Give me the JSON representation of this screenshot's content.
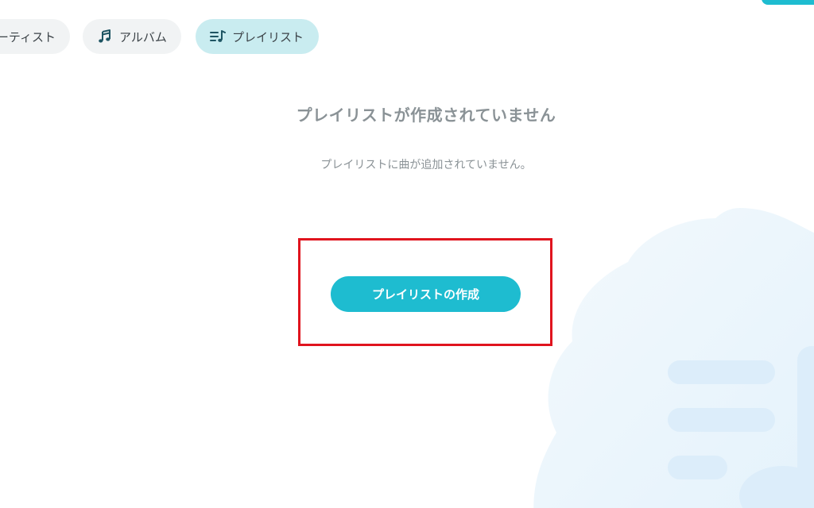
{
  "filter_chips": {
    "artist_label": "ーティスト",
    "album_label": "アルバム",
    "playlist_label": "プレイリスト",
    "album_icon": "music-note-icon",
    "playlist_icon": "playlist-icon",
    "active": "playlist"
  },
  "empty_state": {
    "title": "プレイリストが作成されていません",
    "description": "プレイリストに曲が追加されていません。",
    "create_button_label": "プレイリストの作成"
  },
  "colors": {
    "accent": "#1ebcd0",
    "active_chip": "#c9ecf0",
    "chip": "#f1f3f4",
    "muted_text": "#8a9296",
    "highlight": "#e0141e",
    "decoration": "#e4f3fb"
  }
}
